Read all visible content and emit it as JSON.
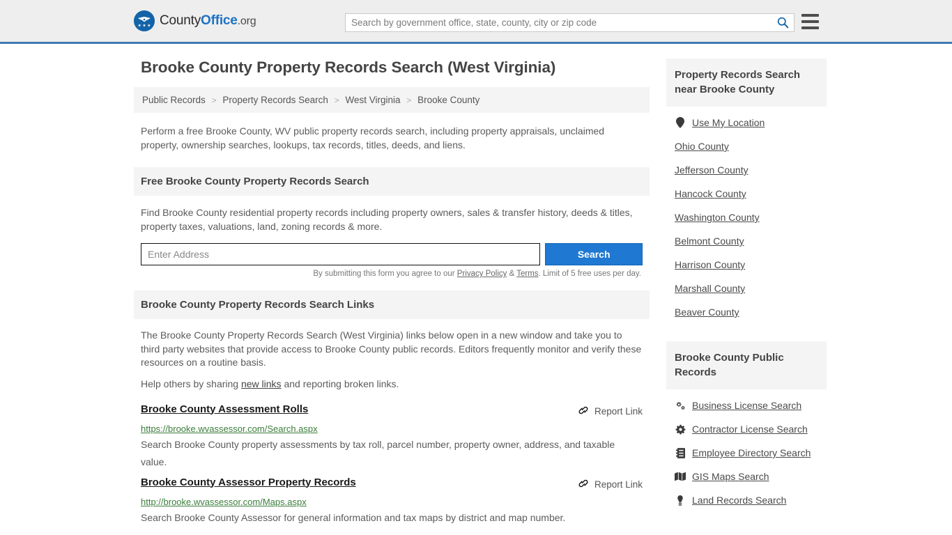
{
  "header": {
    "logo": {
      "part1": "County",
      "part2": "Office",
      "part3": ".org",
      "icon": "eagle-seal-icon"
    },
    "search_placeholder": "Search by government office, state, county, city or zip code",
    "search_value": "",
    "search_icon": "search-icon",
    "menu_icon": "hamburger-menu-icon",
    "accent_color": "#3d7ab1"
  },
  "page": {
    "title": "Brooke County Property Records Search (West Virginia)",
    "breadcrumb": [
      {
        "label": "Public Records"
      },
      {
        "label": "Property Records Search"
      },
      {
        "label": "West Virginia"
      },
      {
        "label": "Brooke County"
      }
    ],
    "breadcrumb_separator": ">",
    "intro": "Perform a free Brooke County, WV public property records search, including property appraisals, unclaimed property, ownership searches, lookups, tax records, titles, deeds, and liens."
  },
  "free_search": {
    "heading": "Free Brooke County Property Records Search",
    "description": "Find Brooke County residential property records including property owners, sales & transfer history, deeds & titles, property taxes, valuations, land, zoning records & more.",
    "input_placeholder": "Enter Address",
    "input_value": "",
    "button_label": "Search",
    "disclaimer_pre": "By submitting this form you agree to our ",
    "disclaimer_privacy": "Privacy Policy",
    "disclaimer_amp": " & ",
    "disclaimer_terms": "Terms",
    "disclaimer_post": ". Limit of 5 free uses per day.",
    "button_color": "#1f78d1"
  },
  "links_section": {
    "heading": "Brooke County Property Records Search Links",
    "paragraph": "The Brooke County Property Records Search (West Virginia) links below open in a new window and take you to third party websites that provide access to Brooke County public records. Editors frequently monitor and verify these resources on a routine basis.",
    "help_pre": "Help others by sharing ",
    "help_link": "new links",
    "help_post": " and reporting broken links.",
    "report_label": "Report Link",
    "report_icon": "broken-link-icon",
    "results": [
      {
        "title": "Brooke County Assessment Rolls",
        "url": "https://brooke.wvassessor.com/Search.aspx",
        "description": "Search Brooke County property assessments by tax roll, parcel number, property owner, address, and taxable value."
      },
      {
        "title": "Brooke County Assessor Property Records",
        "url": "http://brooke.wvassessor.com/Maps.aspx",
        "description": "Search Brooke County Assessor for general information and tax maps by district and map number."
      }
    ]
  },
  "sidebar": {
    "nearby": {
      "heading": "Property Records Search near Brooke County",
      "items": [
        {
          "label": "Use My Location",
          "icon": "map-pin-icon"
        },
        {
          "label": "Ohio County",
          "icon": ""
        },
        {
          "label": "Jefferson County",
          "icon": ""
        },
        {
          "label": "Hancock County",
          "icon": ""
        },
        {
          "label": "Washington County",
          "icon": ""
        },
        {
          "label": "Belmont County",
          "icon": ""
        },
        {
          "label": "Harrison County",
          "icon": ""
        },
        {
          "label": "Marshall County",
          "icon": ""
        },
        {
          "label": "Beaver County",
          "icon": ""
        }
      ]
    },
    "public_records": {
      "heading": "Brooke County Public Records",
      "items": [
        {
          "label": "Business License Search",
          "icon": "cogs-icon"
        },
        {
          "label": "Contractor License Search",
          "icon": "cog-icon"
        },
        {
          "label": "Employee Directory Search",
          "icon": "address-book-icon"
        },
        {
          "label": "GIS Maps Search",
          "icon": "map-icon"
        },
        {
          "label": "Land Records Search",
          "icon": "landmark-icon"
        }
      ]
    }
  }
}
